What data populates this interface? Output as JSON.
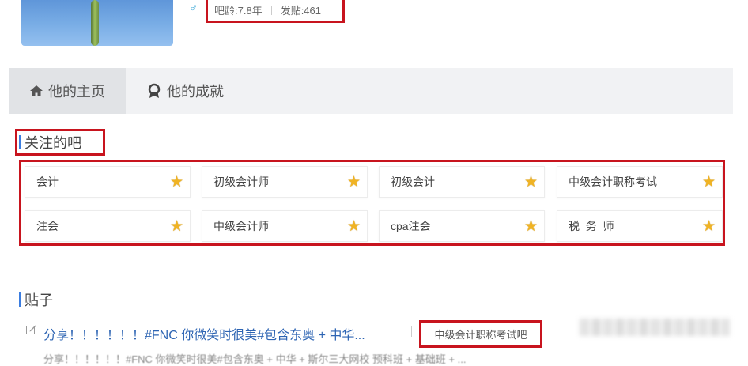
{
  "profile": {
    "gender_icon": "male-icon",
    "age_label": "吧龄:7.8年",
    "posts_label": "发贴:461"
  },
  "tabs": [
    {
      "label": "他的主页",
      "icon": "home-icon"
    },
    {
      "label": "他的成就",
      "icon": "medal-icon"
    }
  ],
  "followed": {
    "title": "关注的吧",
    "bars": [
      {
        "name": "会计"
      },
      {
        "name": "初级会计师"
      },
      {
        "name": "初级会计"
      },
      {
        "name": "中级会计职称考试"
      },
      {
        "name": "注会"
      },
      {
        "name": "中级会计师"
      },
      {
        "name": "cpa注会"
      },
      {
        "name": "税_务_师"
      }
    ]
  },
  "posts": {
    "title": "贴子",
    "items": [
      {
        "title": "分享！！！！！！#FNC 你微笑时很美#包含东奥 + 中华...",
        "forum": "中级会计职称考试吧",
        "snippet": "分享！！！！！！#FNC 你微笑时很美#包含东奥 + 中华 + 斯尔三大网校 预科班 + 基础班 + ..."
      }
    ]
  },
  "colors": {
    "highlight_box": "#c8141e",
    "accent_blue": "#3b7de0",
    "link": "#2d64b3",
    "star": "#f0b323"
  }
}
